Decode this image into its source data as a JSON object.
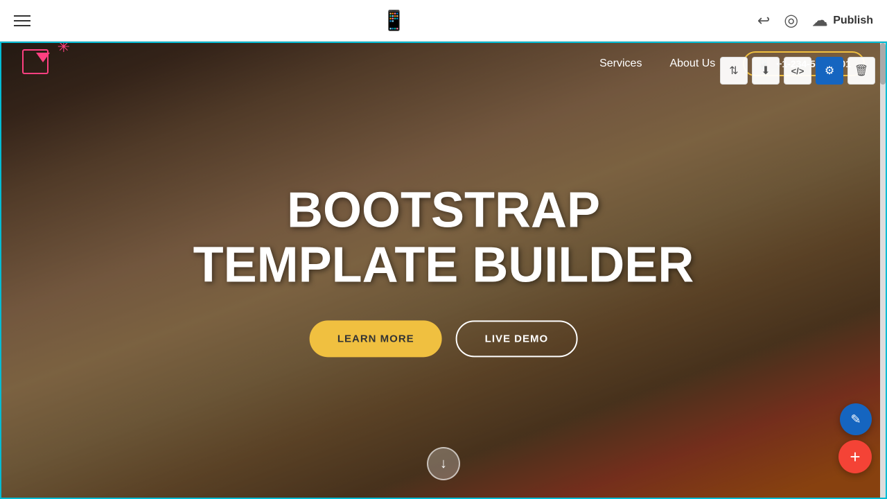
{
  "toolbar": {
    "publish_label": "Publish",
    "undo_symbol": "↩",
    "preview_symbol": "◉"
  },
  "hero": {
    "nav": {
      "services_label": "Services",
      "about_label": "About Us",
      "phone_number": "+1-234-567-8901"
    },
    "title_line1": "BOOTSTRAP",
    "title_line2": "TEMPLATE BUILDER",
    "btn_learn_more": "LEARN MORE",
    "btn_live_demo": "LIVE DEMO",
    "scroll_arrow": "↓"
  },
  "float_toolbar": {
    "sort_icon": "⇅",
    "download_icon": "⬇",
    "code_icon": "</>",
    "settings_icon": "⚙",
    "delete_icon": "🗑"
  },
  "fab": {
    "pencil_icon": "✏",
    "plus_icon": "+"
  }
}
